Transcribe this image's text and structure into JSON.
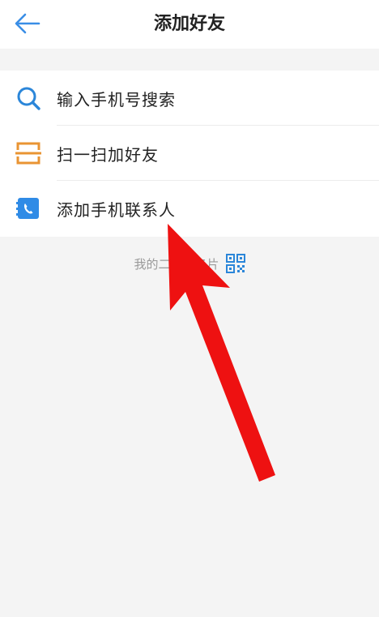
{
  "header": {
    "title": "添加好友",
    "back_icon": "arrow-left-icon"
  },
  "menu": {
    "items": [
      {
        "label": "输入手机号搜索",
        "icon": "search-icon",
        "icon_color": "#2b86d9"
      },
      {
        "label": "扫一扫加好友",
        "icon": "scan-icon",
        "icon_color": "#e99433"
      },
      {
        "label": "添加手机联系人",
        "icon": "phone-contacts-icon",
        "icon_color": "#2f8be6"
      }
    ]
  },
  "qr": {
    "text": "我的二维码名片",
    "icon": "qr-code-icon",
    "icon_color": "#2b86d9"
  },
  "annotation": {
    "color": "#ee1111"
  }
}
